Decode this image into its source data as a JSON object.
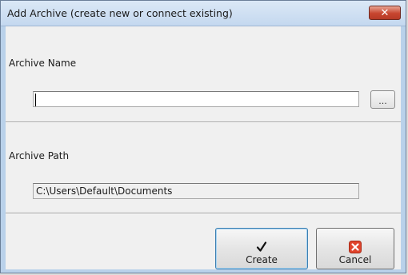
{
  "window": {
    "title": "Add Archive (create new or connect existing)",
    "close_glyph": "✕"
  },
  "archive_name": {
    "label": "Archive Name",
    "value": "",
    "browse_label": "..."
  },
  "archive_path": {
    "label": "Archive Path",
    "value": "C:\\Users\\Default\\Documents"
  },
  "buttons": {
    "create_label": "Create",
    "create_icon": "checkmark-icon",
    "cancel_label": "Cancel",
    "cancel_icon": "cancel-x-icon"
  },
  "colors": {
    "title_bg": "#c4d8ef",
    "close_red": "#c7452f",
    "cancel_red": "#e0442c",
    "dialog_bg": "#f0f0f0"
  }
}
